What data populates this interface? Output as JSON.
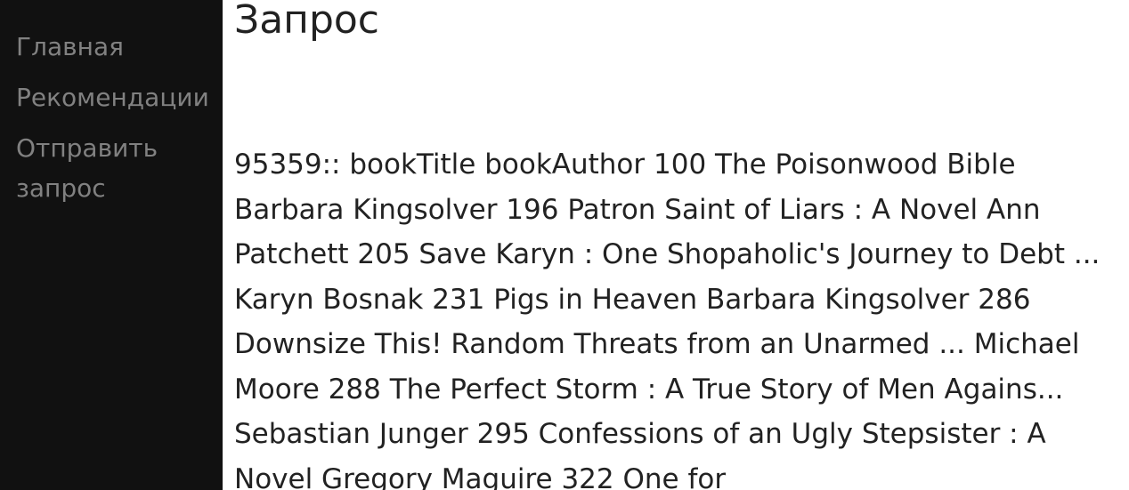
{
  "sidebar": {
    "items": [
      {
        "label": "Главная"
      },
      {
        "label": "Рекомендации"
      },
      {
        "label": "Отправить запрос"
      }
    ]
  },
  "main": {
    "title": "Запрос",
    "result_text": "95359:: bookTitle bookAuthor 100 The Poisonwood Bible Barbara Kingsolver 196 Patron Saint of Liars : A Novel Ann Patchett 205 Save Karyn : One Shopaholic's Journey to Debt ... Karyn Bosnak 231 Pigs in Heaven Barbara Kingsolver 286 Downsize This! Random Threats from an Unarmed ... Michael Moore 288 The Perfect Storm : A True Story of Men Agains... Sebastian Junger 295 Confessions of an Ugly Stepsister : A Novel Gregory Maguire 322 One for"
  },
  "colors": {
    "sidebar_bg": "#111111",
    "nav_text": "#818181",
    "main_text": "#222222"
  }
}
